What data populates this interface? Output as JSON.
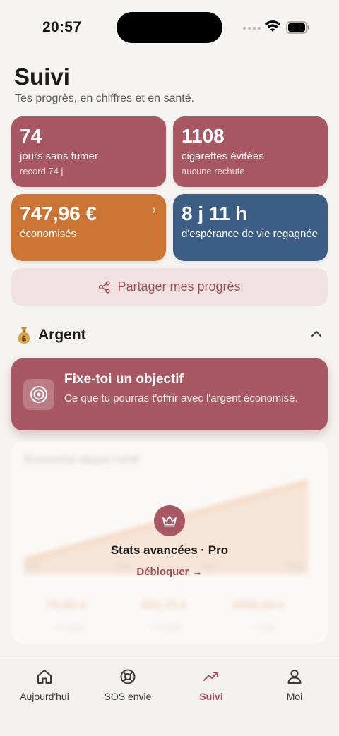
{
  "status_bar": {
    "time": "20:57"
  },
  "header": {
    "title": "Suivi",
    "subtitle": "Tes progrès, en chiffres et en santé."
  },
  "stats": {
    "days": {
      "value": "74",
      "label": "jours sans fumer",
      "sub": "record 74 j"
    },
    "cigarettes": {
      "value": "1108",
      "label": "cigarettes évitées",
      "sub": "aucune rechute"
    },
    "money": {
      "value": "747,96 €",
      "label": "économisés"
    },
    "life": {
      "value": "8 j 11 h",
      "label": "d'espérance de vie regagnée"
    }
  },
  "share_button": {
    "label": "Partager mes progrès"
  },
  "section": {
    "title": "Argent",
    "icon": "money-bag-icon"
  },
  "goal_card": {
    "title": "Fixe-toi un objectif",
    "description": "Ce que tu pourras t'offrir avec l'argent économisé."
  },
  "locked_stats": {
    "title": "Stats avancées · Pro",
    "unlock_label": "Débloquer →",
    "blurred": {
      "chart_title": "Économisé depuis l'arrêt",
      "axis": [
        "Nov",
        "Déc",
        "Jan",
        "Févr"
      ],
      "values": [
        "70,60 €",
        "303,75 €",
        "3005,83 €"
      ],
      "subs": [
        "≈ 1 mois",
        "≈ 1 mois",
        "≈ 1 an"
      ]
    }
  },
  "tabs": [
    {
      "label": "Aujourd'hui",
      "icon": "home-icon"
    },
    {
      "label": "SOS envie",
      "icon": "lifebuoy-icon"
    },
    {
      "label": "Suivi",
      "icon": "trending-up-icon",
      "active": true
    },
    {
      "label": "Moi",
      "icon": "person-icon"
    }
  ],
  "colors": {
    "accent": "#a85863",
    "orange": "#cc7433",
    "blue": "#3c5d85",
    "background": "#f6f4f1"
  }
}
